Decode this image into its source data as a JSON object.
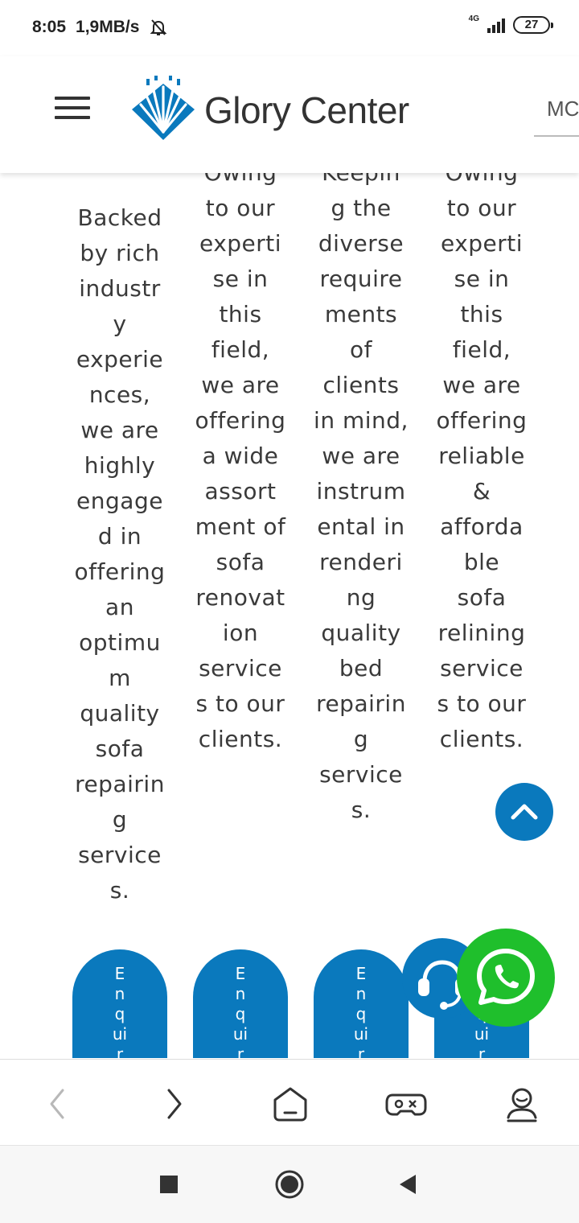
{
  "status": {
    "time": "8:05",
    "speed": "1,9MB/s",
    "network": "4G",
    "battery": "27"
  },
  "header": {
    "brand": "Glory Center",
    "language_btn": "MC",
    "logo_color": "#0a79bd"
  },
  "columns": [
    {
      "text": "Backed\nby rich\nindustr\ny\nexperie\nnces,\nwe are\nhighly\nengage\nd in\noffering\nan\noptimu\nm\nquality\nsofa\nrepairin\ng\nservice\ns."
    },
    {
      "text": "Owing\nto our\nexperti\nse in\nthis\nfield,\nwe are\noffering\na wide\nassort\nment of\nsofa\nrenovat\nion\nservice\ns to our\nclients."
    },
    {
      "text": "Keepin\ng the\ndiverse\nrequire\nments\nof\nclients\nin mind,\nwe are\ninstrum\nental in\nrenderi\nng\nquality\nbed\nrepairin\ng\nservice\ns."
    },
    {
      "text": "Owing\nto our\nexperti\nse in\nthis\nfield,\nwe are\noffering\nreliable\n&\naffordа\nble\nsofa\nrelining\nservice\ns to our\nclients."
    }
  ],
  "enquiry_label": "E\nn\nq\nui\nr",
  "colors": {
    "accent": "#0a79bd",
    "whatsapp": "#1fbf2c"
  },
  "icons": {
    "menu": "hamburger-icon",
    "scroll_top": "chevron-up-icon",
    "support": "headset-icon",
    "whatsapp": "whatsapp-icon",
    "back": "chevron-left-icon",
    "forward": "chevron-right-icon",
    "home": "home-icon",
    "games": "gamepad-icon",
    "profile": "user-icon"
  }
}
